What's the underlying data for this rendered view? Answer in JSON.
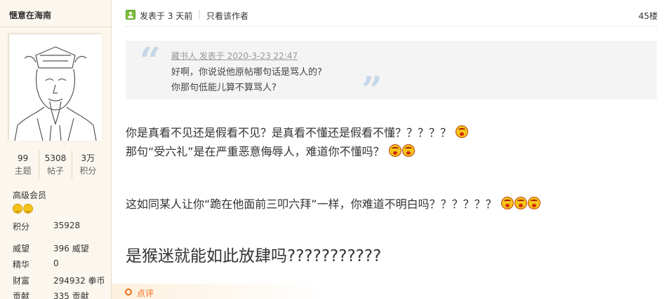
{
  "author": {
    "name": "惬意在海南",
    "stats": [
      {
        "value": "99",
        "label": "主题"
      },
      {
        "value": "5308",
        "label": "帖子"
      },
      {
        "value": "3万",
        "label": "积分"
      }
    ],
    "rank": "高级会员",
    "info": [
      {
        "key": "积分",
        "value": "35928"
      },
      {
        "key": "威望",
        "value": "396 威望"
      },
      {
        "key": "精华",
        "value": "0"
      },
      {
        "key": "财富",
        "value": "294932 拳币"
      },
      {
        "key": "贡献",
        "value": "335 贡献"
      }
    ]
  },
  "post": {
    "posted_at": "发表于 3 天前",
    "separator": "|",
    "only_author": "只看该作者",
    "floor": "45楼",
    "quote": {
      "meta": "藏书人 发表于 2020-3-23 22:47",
      "line1": "好啊，你说说他原帖哪句话是骂人的?",
      "line2": "你那句低能儿算不算骂人?"
    },
    "lines": [
      "你是真看不见还是假看不见？是真看不懂还是假看不懂？？？？？",
      "那句“受六礼”是在严重恶意侮辱人，难道你不懂吗？",
      "这如同某人让你“跪在他面前三叩六拜”一样，你难道不明白吗？？？？？？",
      "是猴迷就能如此放肆吗???????????"
    ],
    "comment_label": "点评"
  }
}
